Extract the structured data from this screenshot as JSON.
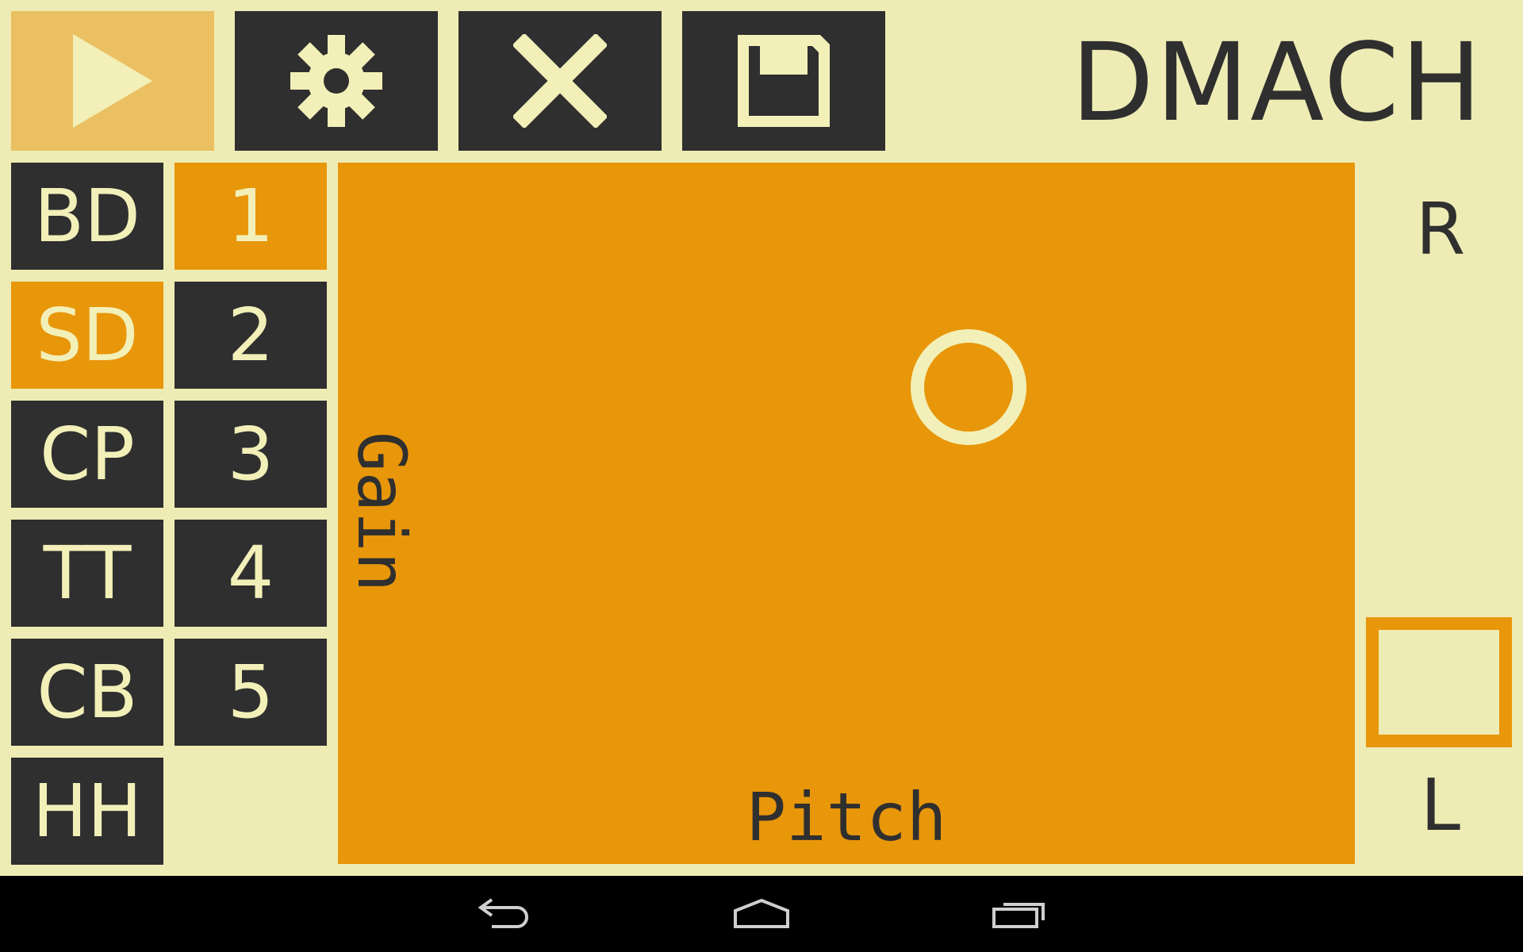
{
  "app": {
    "title": "DMACH"
  },
  "toolbar": {
    "play_icon": "play-icon",
    "settings_icon": "gear-icon",
    "clear_icon": "close-icon",
    "save_icon": "floppy-disk-icon"
  },
  "instruments": [
    {
      "label": "BD",
      "active": false
    },
    {
      "label": "SD",
      "active": true
    },
    {
      "label": "CP",
      "active": false
    },
    {
      "label": "TT",
      "active": false
    },
    {
      "label": "CB",
      "active": false
    },
    {
      "label": "HH",
      "active": false
    }
  ],
  "patterns": [
    {
      "label": "1",
      "active": true
    },
    {
      "label": "2",
      "active": false
    },
    {
      "label": "3",
      "active": false
    },
    {
      "label": "4",
      "active": false
    },
    {
      "label": "5",
      "active": false
    }
  ],
  "pad": {
    "x_label": "Pitch",
    "y_label": "Gain",
    "x_value": 0.62,
    "y_value": 0.68
  },
  "pan": {
    "top_label": "R",
    "bottom_label": "L"
  },
  "colors": {
    "background": "#eeecb4",
    "dark": "#2f2f2f",
    "accent": "#e8960a",
    "play": "#ebc062",
    "foreground": "#f2f0b8"
  },
  "navbar": {
    "back_icon": "back-icon",
    "home_icon": "home-icon",
    "recents_icon": "recents-icon"
  }
}
